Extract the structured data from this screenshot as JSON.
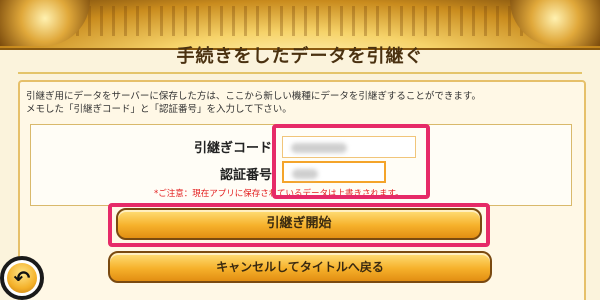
{
  "header": {
    "title": "手続きをしたデータを引継ぐ"
  },
  "description": {
    "line1": "引継ぎ用にデータをサーバーに保存した方は、ここから新しい機種にデータを引継ぎすることができます。",
    "line2": "メモした「引継ぎコード」と「認証番号」を入力して下さい。"
  },
  "form": {
    "code_label": "引継ぎコード",
    "auth_label": "認証番号",
    "code_value": "",
    "auth_value": "",
    "notice": "*ご注意：現在アプリに保存されているデータは上書きされます。"
  },
  "buttons": {
    "start_label": "引継ぎ開始",
    "cancel_label": "キャンセルしてタイトルへ戻る"
  },
  "icons": {
    "back": "back-arrow-icon"
  },
  "colors": {
    "accent": "#e62a68",
    "button": "#f6b12b",
    "notice": "#e31d1d",
    "panel": "#fbf3dc"
  }
}
